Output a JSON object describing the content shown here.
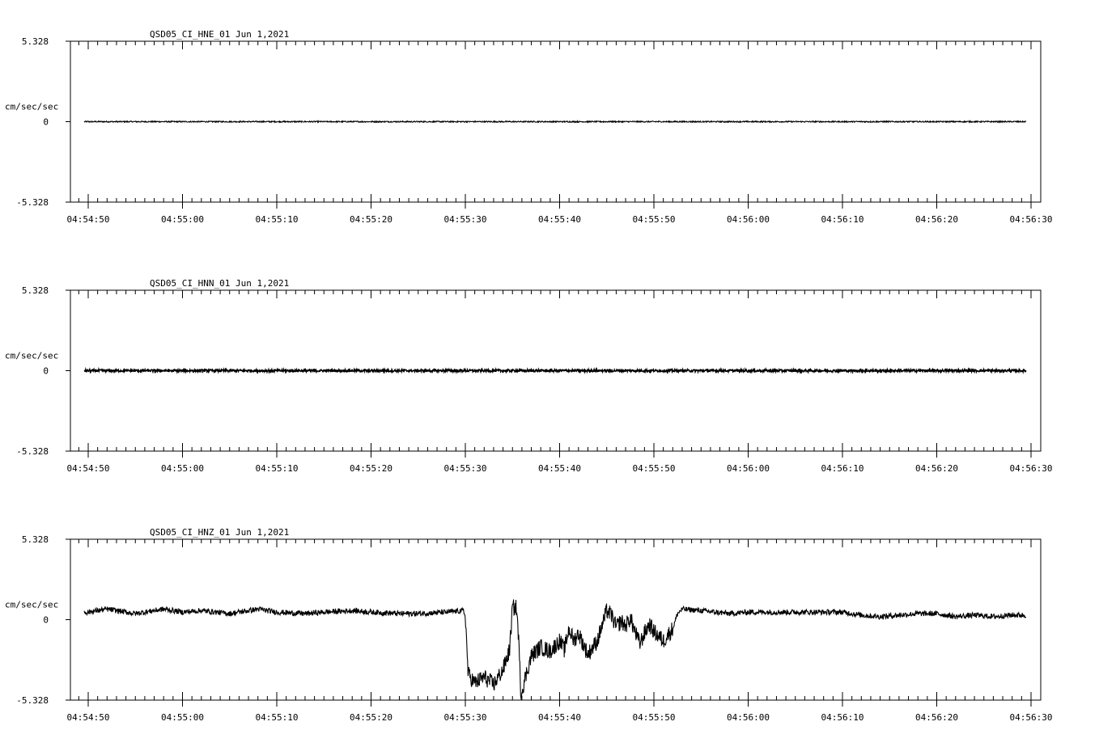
{
  "chart_data": [
    {
      "type": "line",
      "title": "QSD05_CI_HNE_01  Jun 1,2021",
      "ylabel": "cm/sec/sec",
      "ylim": [
        -5.328,
        5.328
      ],
      "y_ticks": [
        "5.328",
        "0",
        "-5.328"
      ],
      "x_ticks": [
        "04:54:50",
        "04:55:00",
        "04:55:10",
        "04:55:20",
        "04:55:30",
        "04:55:40",
        "04:55:50",
        "04:56:00",
        "04:56:10",
        "04:56:20",
        "04:56:30"
      ],
      "x_range_seconds": [
        0,
        100
      ],
      "series": [
        {
          "x": [
            0.0,
            10,
            20,
            30,
            40,
            50,
            60,
            70,
            80,
            90,
            100
          ],
          "y": [
            0.0,
            0.0,
            0.0,
            0.0,
            0.0,
            0.0,
            0.0,
            0.0,
            0.0,
            0.0,
            0.0
          ],
          "noise": 0.04
        }
      ],
      "grid": false,
      "legend": "none"
    },
    {
      "type": "line",
      "title": "QSD05_CI_HNN_01  Jun 1,2021",
      "ylabel": "cm/sec/sec",
      "ylim": [
        -5.328,
        5.328
      ],
      "y_ticks": [
        "5.328",
        "0",
        "-5.328"
      ],
      "x_ticks": [
        "04:54:50",
        "04:55:00",
        "04:55:10",
        "04:55:20",
        "04:55:30",
        "04:55:40",
        "04:55:50",
        "04:56:00",
        "04:56:10",
        "04:56:20",
        "04:56:30"
      ],
      "x_range_seconds": [
        0,
        100
      ],
      "series": [
        {
          "x": [
            0.0,
            10,
            20,
            30,
            40,
            50,
            60,
            70,
            80,
            90,
            100
          ],
          "y": [
            0.0,
            0.0,
            0.0,
            0.0,
            0.0,
            0.0,
            0.0,
            0.0,
            0.0,
            0.0,
            0.0
          ],
          "noise": 0.08
        }
      ],
      "grid": false,
      "legend": "none"
    },
    {
      "type": "line",
      "title": "QSD05_CI_HNZ_01  Jun 1,2021",
      "ylabel": "cm/sec/sec",
      "ylim": [
        -5.328,
        5.328
      ],
      "y_ticks": [
        "5.328",
        "0",
        "-5.328"
      ],
      "x_ticks": [
        "04:54:50",
        "04:55:00",
        "04:55:10",
        "04:55:20",
        "04:55:30",
        "04:55:40",
        "04:55:50",
        "04:56:00",
        "04:56:10",
        "04:56:20",
        "04:56:30"
      ],
      "x_range_seconds": [
        0,
        100
      ],
      "series": [
        {
          "x": [
            0.0,
            2,
            5,
            8,
            10,
            12,
            15,
            18,
            20,
            23,
            25,
            28,
            30,
            33,
            35,
            38,
            39.8,
            40.0,
            40.3,
            41,
            42,
            43,
            44,
            44.7,
            45.0,
            45.4,
            45.6,
            45.9,
            46.2,
            47,
            48,
            49,
            50,
            50.5,
            51,
            51.5,
            52,
            53,
            54,
            55,
            55.5,
            56,
            56.5,
            57,
            57.5,
            58,
            58.5,
            59,
            59.5,
            60,
            61,
            62,
            62.5,
            63,
            65,
            68,
            70,
            75,
            80,
            82,
            84,
            86,
            88,
            90,
            92,
            94,
            96,
            98,
            99.5
          ],
          "y": [
            0.5,
            0.7,
            0.4,
            0.7,
            0.5,
            0.6,
            0.4,
            0.7,
            0.5,
            0.4,
            0.5,
            0.6,
            0.5,
            0.4,
            0.4,
            0.5,
            0.6,
            0.2,
            -3.6,
            -4.2,
            -3.8,
            -4.3,
            -3.3,
            -2.0,
            0.8,
            0.8,
            -0.6,
            -5.0,
            -4.2,
            -2.4,
            -1.8,
            -2.1,
            -1.4,
            -2.0,
            -0.6,
            -1.4,
            -0.9,
            -2.3,
            -1.4,
            0.6,
            0.3,
            -0.5,
            -0.1,
            -0.4,
            0.1,
            -0.8,
            -1.6,
            -0.9,
            -0.3,
            -0.8,
            -1.4,
            -0.6,
            0.4,
            0.7,
            0.6,
            0.4,
            0.5,
            0.5,
            0.5,
            0.3,
            0.2,
            0.3,
            0.4,
            0.4,
            0.2,
            0.3,
            0.2,
            0.3,
            0.3
          ],
          "noise": 0.18
        }
      ],
      "grid": false,
      "legend": "none"
    }
  ]
}
